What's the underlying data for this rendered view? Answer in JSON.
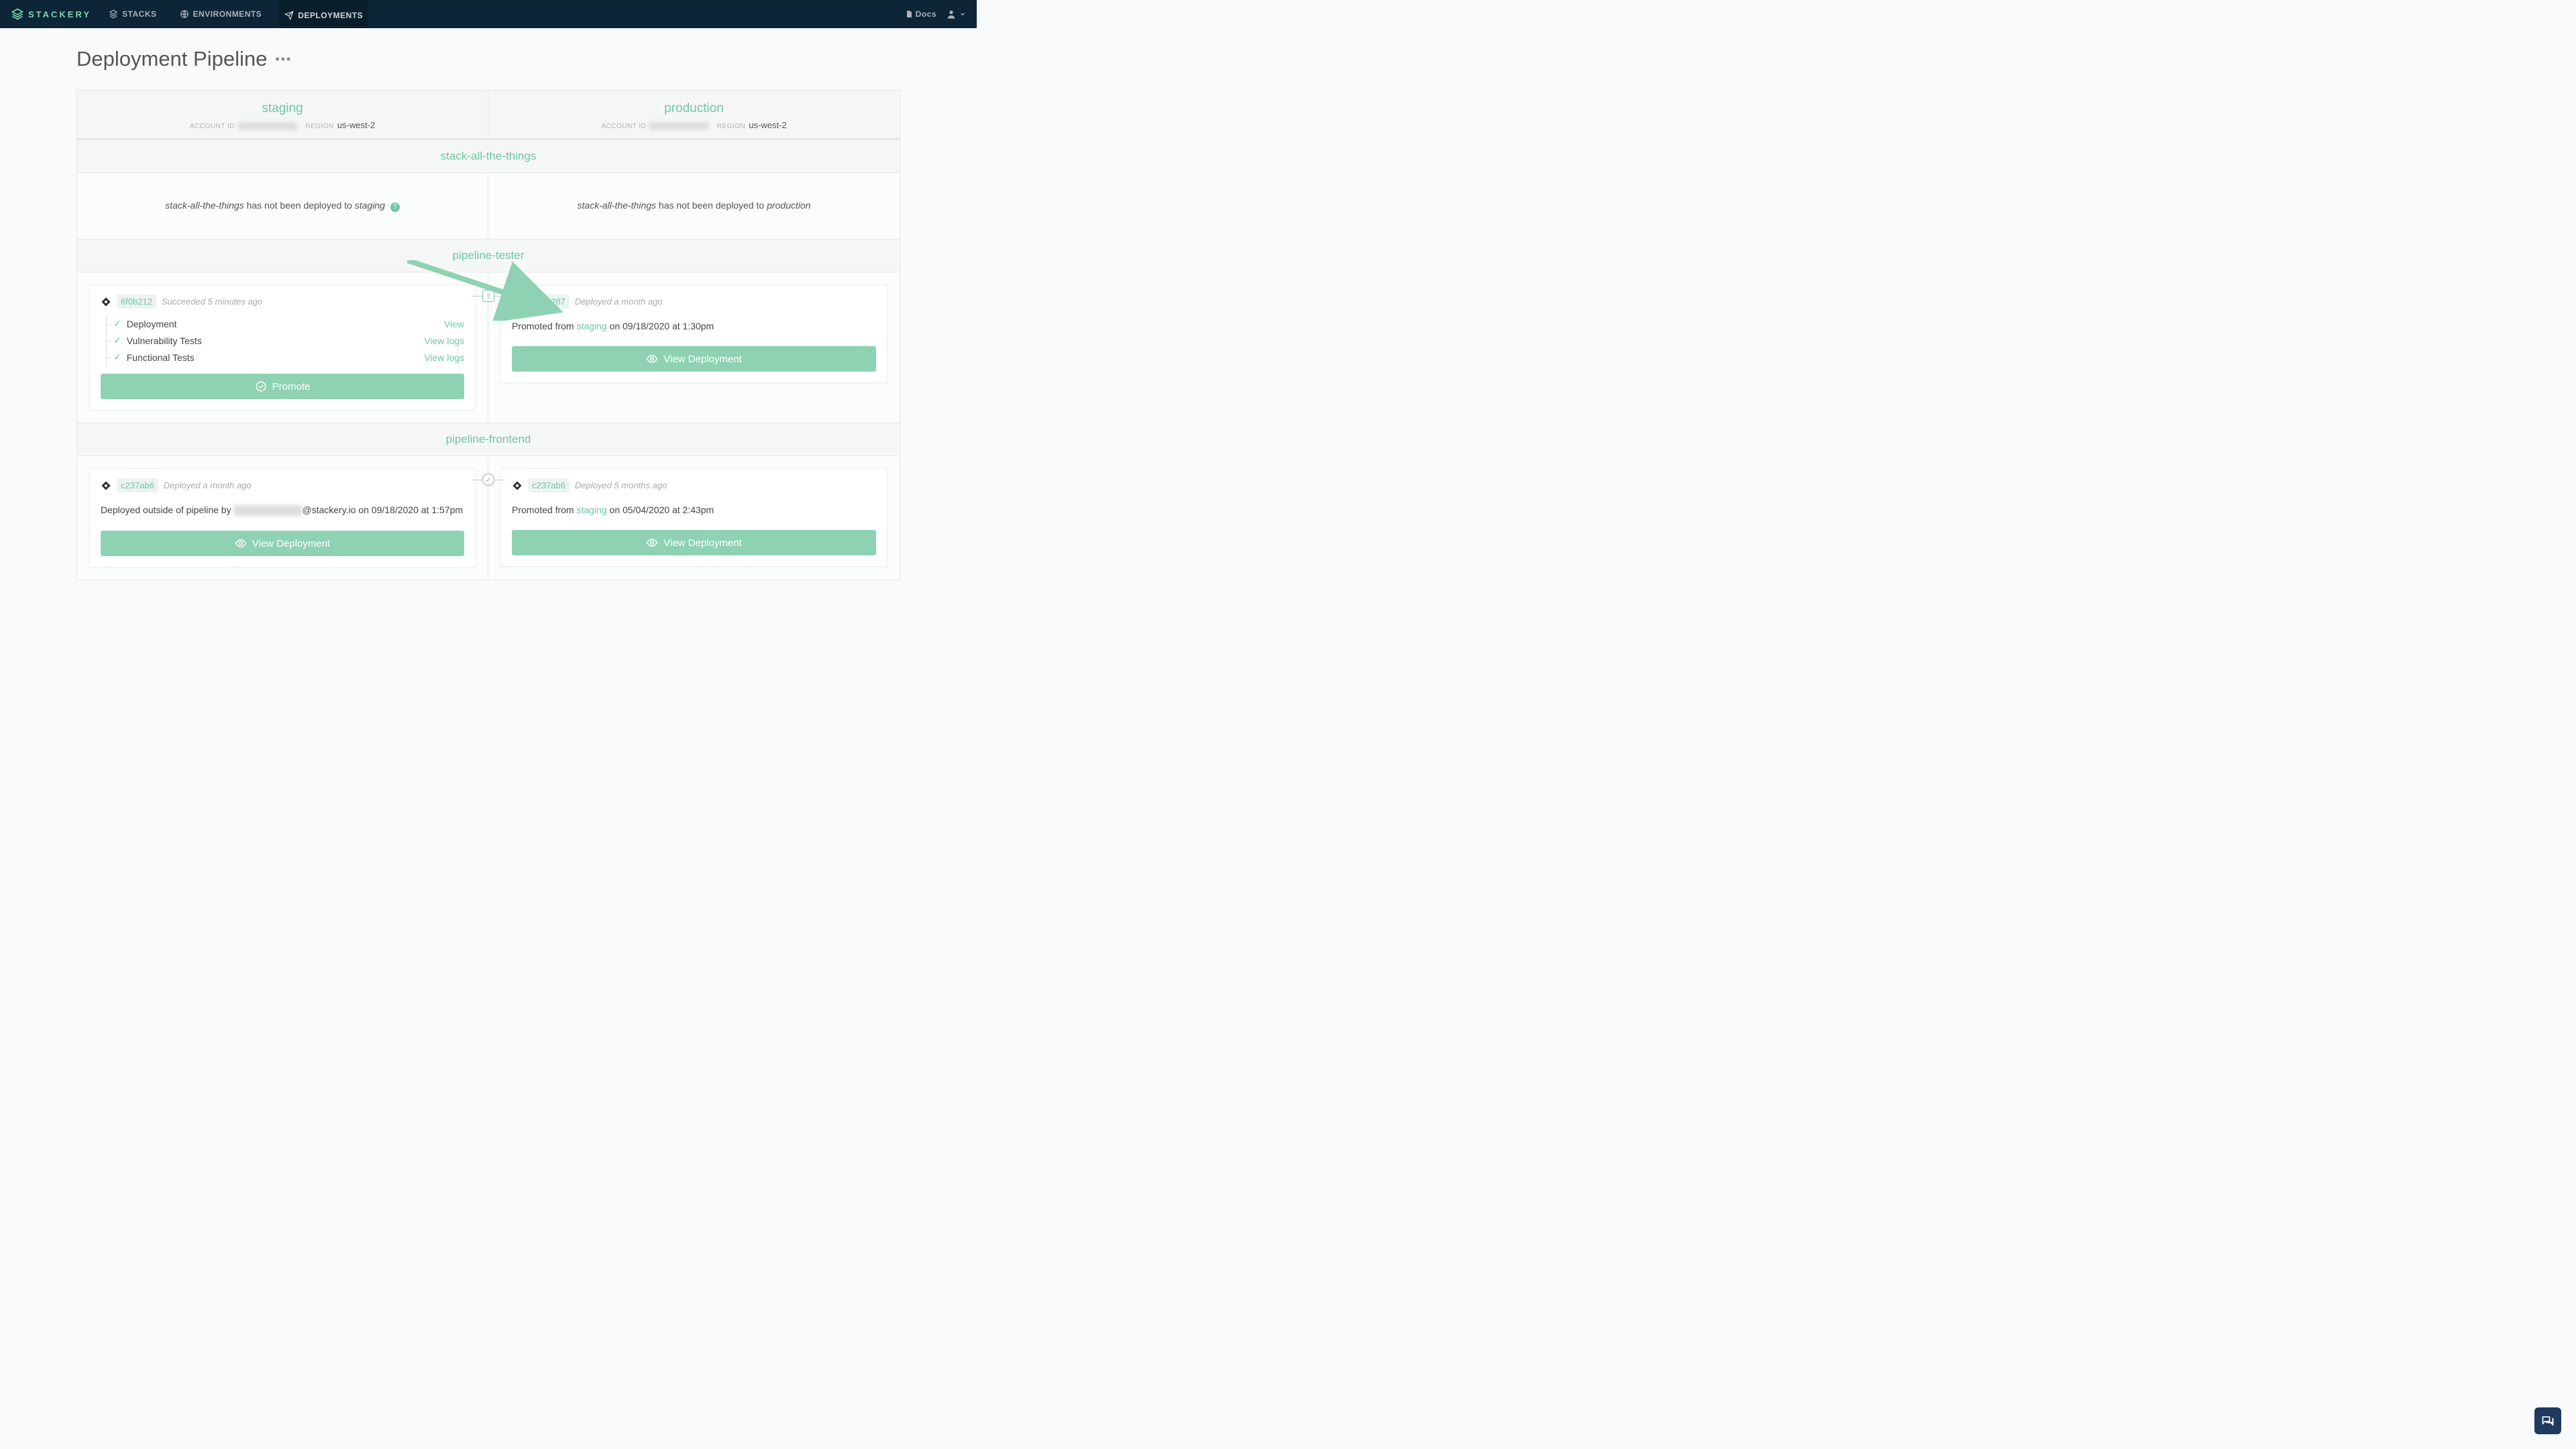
{
  "nav": {
    "brand": "STACKERY",
    "items": [
      {
        "icon": "stacks",
        "label": "STACKS"
      },
      {
        "icon": "globe",
        "label": "ENVIRONMENTS"
      },
      {
        "icon": "plane",
        "label": "DEPLOYMENTS"
      }
    ],
    "docs": "Docs"
  },
  "page": {
    "title": "Deployment Pipeline"
  },
  "envs": {
    "staging": {
      "name": "staging",
      "account_lbl": "ACCOUNT ID",
      "account": "XXXXXXXXXXXX",
      "region_lbl": "REGION",
      "region": "us-west-2"
    },
    "production": {
      "name": "production",
      "account_lbl": "ACCOUNT ID",
      "account": "XXXXXXXXXXXX",
      "region_lbl": "REGION",
      "region": "us-west-2"
    }
  },
  "stacks": [
    {
      "name": "stack-all-the-things",
      "staging_empty": {
        "stack": "stack-all-the-things",
        "mid": " has not been deployed to ",
        "env": "staging"
      },
      "production_empty": {
        "stack": "stack-all-the-things",
        "mid": " has not been deployed to ",
        "env": "production"
      }
    },
    {
      "name": "pipeline-tester",
      "staging_card": {
        "commit": "6f0b212",
        "status": "Succeeded 5 minutes ago",
        "steps": [
          {
            "label": "Deployment",
            "action": "View"
          },
          {
            "label": "Vulnerability Tests",
            "action": "View logs"
          },
          {
            "label": "Functional Tests",
            "action": "View logs"
          }
        ],
        "button": "Promote"
      },
      "production_card": {
        "commit": "0ec8287",
        "status": "Deployed a month ago",
        "msg_pre": "Promoted from ",
        "msg_env": "staging",
        "msg_post": " on 09/18/2020 at 1:30pm",
        "button": "View Deployment"
      },
      "connector": "promote"
    },
    {
      "name": "pipeline-frontend",
      "staging_card": {
        "commit": "c237ab6",
        "status": "Deployed a month ago",
        "msg_pre": "Deployed outside of pipeline by ",
        "msg_blur": "xxxxx xxxxxxxxx",
        "msg_post": "@stackery.io on 09/18/2020 at 1:57pm",
        "button": "View Deployment"
      },
      "production_card": {
        "commit": "c237ab6",
        "status": "Deployed 5 months ago",
        "msg_pre": "Promoted from ",
        "msg_env": "staging",
        "msg_post": " on 05/04/2020 at 2:43pm",
        "button": "View Deployment"
      },
      "connector": "check"
    }
  ]
}
